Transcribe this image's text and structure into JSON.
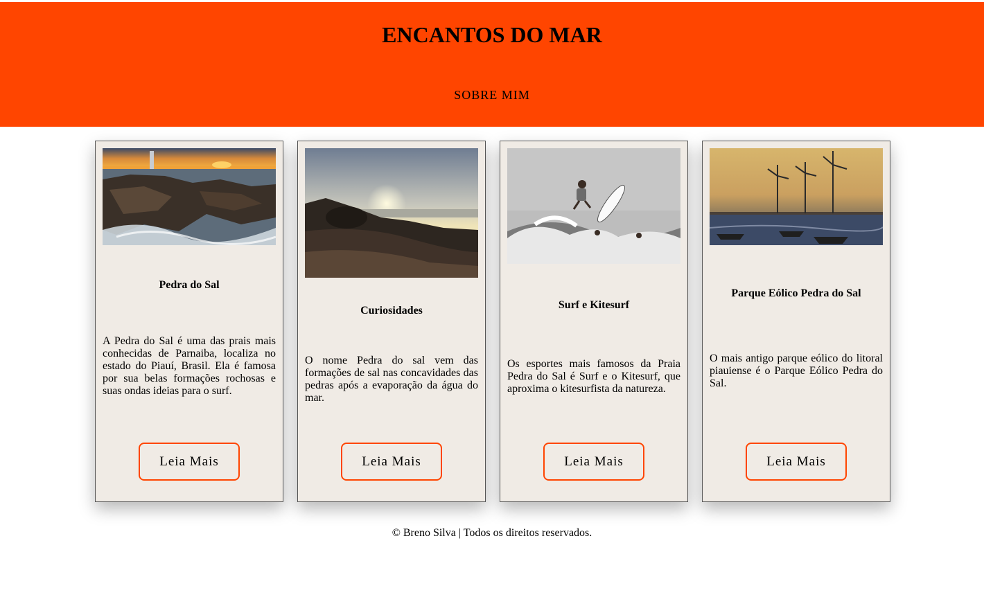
{
  "header": {
    "title": "ENCANTOS DO MAR",
    "nav_link": "SOBRE MIM"
  },
  "cards": [
    {
      "title": "Pedra do Sal",
      "text": "A Pedra do Sal é uma das prais mais conhecidas de Parnaiba, localiza no estado do Piauí, Brasil. Ela é famosa por sua belas formações rochosas e suas ondas ideias para o surf.",
      "button": "Leia Mais"
    },
    {
      "title": "Curiosidades",
      "text": "O nome Pedra do sal vem das formações de sal nas concavidades das pedras após a evaporação da água do mar.",
      "button": "Leia Mais"
    },
    {
      "title": "Surf e Kitesurf",
      "text": "Os esportes mais famosos da Praia Pedra do Sal é Surf e o Kitesurf, que aproxima o kitesurfista da natureza.",
      "button": "Leia Mais"
    },
    {
      "title": "Parque Eólico Pedra do Sal",
      "text": "O mais antigo parque eólico do litoral piauiense é o Parque Eólico Pedra do Sal.",
      "button": "Leia Mais"
    }
  ],
  "footer": {
    "text": "© Breno Silva | Todos os direitos reservados."
  },
  "colors": {
    "header_bg": "#ff4500",
    "card_bg": "#f0ebe5",
    "button_border": "#ff4500"
  }
}
